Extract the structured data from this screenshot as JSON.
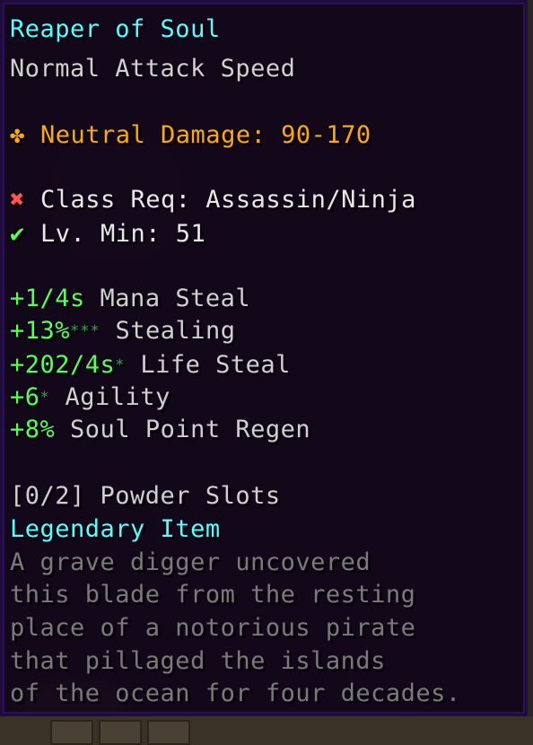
{
  "item": {
    "name": "Reaper of Soul",
    "attack_speed": "Normal Attack Speed",
    "damage": {
      "icon": "neutral-damage-icon",
      "icon_glyph": "✤",
      "text": "Neutral Damage: 90-170",
      "color": "#ffaa00"
    },
    "requirements": {
      "class": {
        "icon": "cross-icon",
        "icon_glyph": "✖",
        "text": "Class Req: Assassin/Ninja",
        "met": false
      },
      "level": {
        "icon": "check-icon",
        "icon_glyph": "✔",
        "text": "Lv. Min: 51",
        "met": true
      }
    },
    "identifications": [
      {
        "value": "+1/4s",
        "stars": "",
        "name": "Mana Steal"
      },
      {
        "value": "+13%",
        "stars": "***",
        "name": "Stealing"
      },
      {
        "value": "+202/4s",
        "stars": "*",
        "name": "Life Steal"
      },
      {
        "value": "+6",
        "stars": "*",
        "name": "Agility"
      },
      {
        "value": "+8%",
        "stars": "",
        "name": "Soul Point Regen"
      }
    ],
    "powder_slots": "[0/2] Powder Slots",
    "tier": "Legendary Item",
    "lore": [
      "A grave digger uncovered",
      "this blade from the resting",
      "place of a notorious pirate",
      "that pillaged the islands",
      "of the ocean for four decades."
    ]
  },
  "colors": {
    "name": "#55ffff",
    "tier": "#55ffff",
    "positive": "#55ff55",
    "negative": "#ff5555",
    "lore": "#7a7a7a"
  }
}
